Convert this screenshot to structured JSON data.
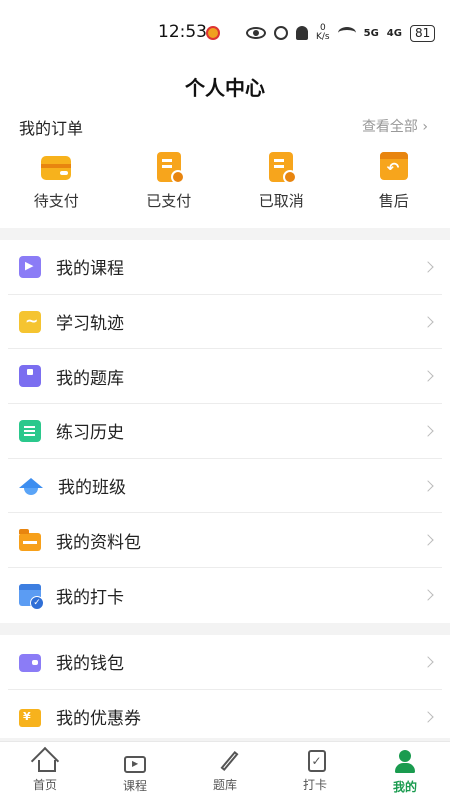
{
  "status_bar": {
    "time": "12:53",
    "speed_value": "0",
    "speed_unit": "K/s",
    "net1": "5G",
    "net2": "4G",
    "battery": "81"
  },
  "header": {
    "title": "个人中心"
  },
  "orders": {
    "title": "我的订单",
    "view_all": "查看全部 ›",
    "items": [
      {
        "label": "待支付",
        "icon": "wallet-icon"
      },
      {
        "label": "已支付",
        "icon": "receipt-check-icon"
      },
      {
        "label": "已取消",
        "icon": "receipt-cancel-icon"
      },
      {
        "label": "售后",
        "icon": "return-box-icon"
      }
    ]
  },
  "menu_main": [
    {
      "label": "我的课程",
      "icon": "course-video-icon"
    },
    {
      "label": "学习轨迹",
      "icon": "learning-track-icon"
    },
    {
      "label": "我的题库",
      "icon": "question-bank-icon"
    },
    {
      "label": "练习历史",
      "icon": "practice-history-icon"
    },
    {
      "label": "我的班级",
      "icon": "graduation-cap-icon"
    },
    {
      "label": "我的资料包",
      "icon": "folder-icon"
    },
    {
      "label": "我的打卡",
      "icon": "calendar-check-icon"
    }
  ],
  "menu_secondary": [
    {
      "label": "我的钱包",
      "icon": "wallet-icon"
    },
    {
      "label": "我的优惠券",
      "icon": "coupon-icon"
    }
  ],
  "bottom_nav": [
    {
      "label": "首页",
      "icon": "home-icon"
    },
    {
      "label": "课程",
      "icon": "tv-play-icon"
    },
    {
      "label": "题库",
      "icon": "pencil-icon"
    },
    {
      "label": "打卡",
      "icon": "clipboard-check-icon"
    },
    {
      "label": "我的",
      "icon": "user-icon",
      "active": true
    }
  ],
  "colors": {
    "accent": "#1a9b4f",
    "order_icon": "#f7a51c"
  }
}
